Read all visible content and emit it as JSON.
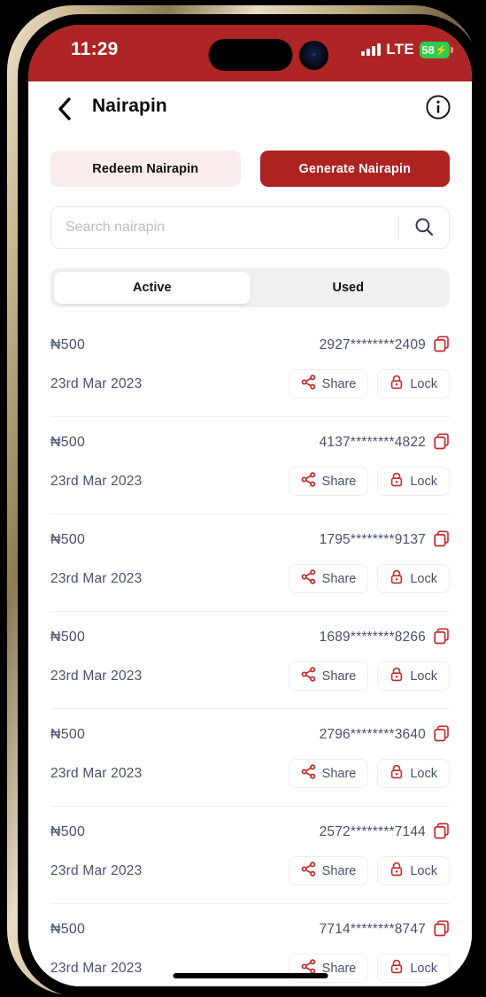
{
  "status_bar": {
    "time": "11:29",
    "network": "LTE",
    "battery_level": "58",
    "battery_bolt": "⚡",
    "signal_icon": "cellular-signal-icon"
  },
  "header": {
    "title": "Nairapin",
    "back_icon": "chevron-left-icon",
    "info_icon": "info-circle-icon"
  },
  "actions": {
    "redeem_label": "Redeem Nairapin",
    "generate_label": "Generate Nairapin"
  },
  "search": {
    "placeholder": "Search nairapin",
    "value": "",
    "icon": "search-icon"
  },
  "tabs": [
    {
      "label": "Active",
      "active": true
    },
    {
      "label": "Used",
      "active": false
    }
  ],
  "row_actions": {
    "share_label": "Share",
    "lock_label": "Lock",
    "share_icon": "share-icon",
    "lock_icon": "lock-icon",
    "copy_icon": "copy-icon"
  },
  "pins": [
    {
      "amount": "₦500",
      "code": "2927********2409",
      "date": "23rd Mar 2023"
    },
    {
      "amount": "₦500",
      "code": "4137********4822",
      "date": "23rd Mar 2023"
    },
    {
      "amount": "₦500",
      "code": "1795********9137",
      "date": "23rd Mar 2023"
    },
    {
      "amount": "₦500",
      "code": "1689********8266",
      "date": "23rd Mar 2023"
    },
    {
      "amount": "₦500",
      "code": "2796********3640",
      "date": "23rd Mar 2023"
    },
    {
      "amount": "₦500",
      "code": "2572********7144",
      "date": "23rd Mar 2023"
    },
    {
      "amount": "₦500",
      "code": "7714********8747",
      "date": "23rd Mar 2023"
    }
  ],
  "colors": {
    "brand_red": "#AF2222",
    "status_bar_red": "#AF2424",
    "brand_red_tint": "#FAECEB",
    "text_slate": "#49526b",
    "battery_green": "#2ECC4A"
  }
}
